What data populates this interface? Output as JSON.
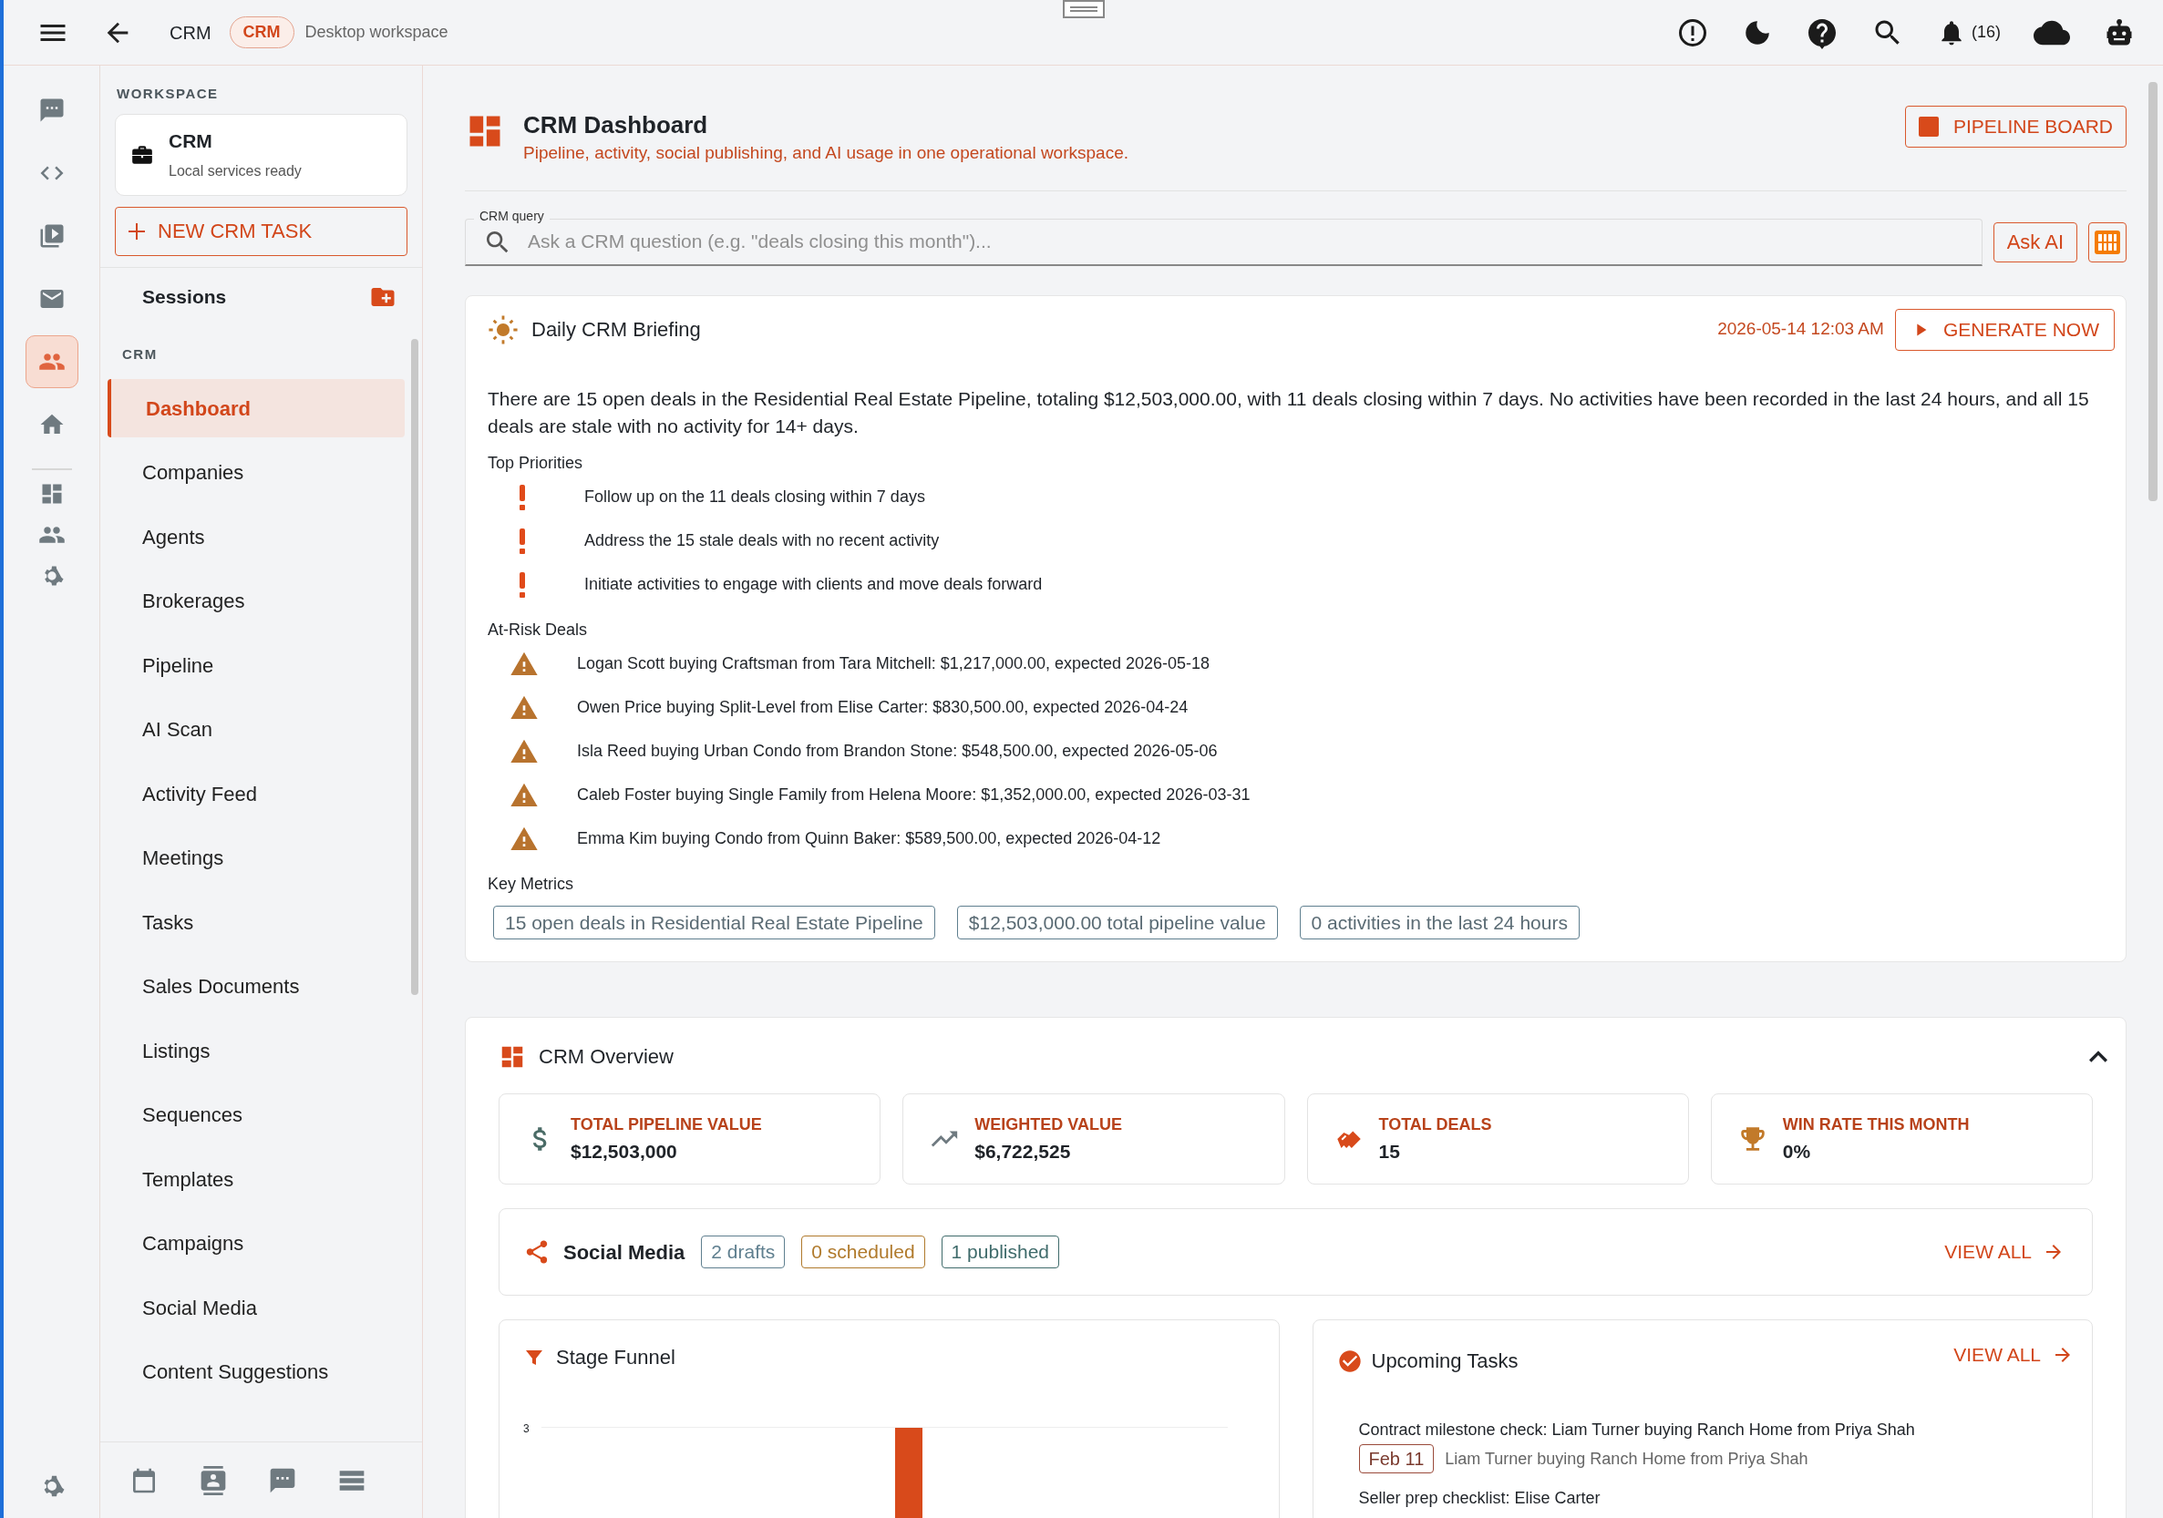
{
  "topbar": {
    "breadcrumb": "CRM",
    "badge": "CRM",
    "subtitle": "Desktop workspace",
    "notification_count": "(16)"
  },
  "rail": [
    {
      "selected": false
    },
    {
      "selected": false
    },
    {
      "selected": false
    },
    {
      "selected": false
    },
    {
      "selected": true
    },
    {
      "selected": false
    }
  ],
  "sidebar": {
    "workspace_label": "WORKSPACE",
    "workspace_card": {
      "title": "CRM",
      "status": "Local services ready"
    },
    "new_task_button": "NEW CRM TASK",
    "sessions_label": "Sessions",
    "section_label": "CRM",
    "items": [
      {
        "label": "Dashboard",
        "selected": true
      },
      {
        "label": "Companies",
        "selected": false
      },
      {
        "label": "Agents",
        "selected": false
      },
      {
        "label": "Brokerages",
        "selected": false
      },
      {
        "label": "Pipeline",
        "selected": false
      },
      {
        "label": "AI Scan",
        "selected": false
      },
      {
        "label": "Activity Feed",
        "selected": false
      },
      {
        "label": "Meetings",
        "selected": false
      },
      {
        "label": "Tasks",
        "selected": false
      },
      {
        "label": "Sales Documents",
        "selected": false
      },
      {
        "label": "Listings",
        "selected": false
      },
      {
        "label": "Sequences",
        "selected": false
      },
      {
        "label": "Templates",
        "selected": false
      },
      {
        "label": "Campaigns",
        "selected": false
      },
      {
        "label": "Social Media",
        "selected": false
      },
      {
        "label": "Content Suggestions",
        "selected": false
      }
    ]
  },
  "header": {
    "title": "CRM Dashboard",
    "subtitle": "Pipeline, activity, social publishing, and AI usage in one operational workspace.",
    "pipeline_button": "PIPELINE BOARD"
  },
  "query": {
    "label": "CRM query",
    "placeholder": "Ask a CRM question (e.g. \"deals closing this month\")...",
    "ask_button": "Ask AI"
  },
  "briefing": {
    "title": "Daily CRM Briefing",
    "timestamp": "2026-05-14 12:03 AM",
    "generate_button": "GENERATE NOW",
    "summary": "There are 15 open deals in the Residential Real Estate Pipeline, totaling $12,503,000.00, with 11 deals closing within 7 days. No activities have been recorded in the last 24 hours, and all 15 deals are stale with no activity for 14+ days.",
    "priorities_title": "Top Priorities",
    "priorities": [
      "Follow up on the 11 deals closing within 7 days",
      "Address the 15 stale deals with no recent activity",
      "Initiate activities to engage with clients and move deals forward"
    ],
    "at_risk_title": "At-Risk Deals",
    "at_risk": [
      "Logan Scott buying Craftsman from Tara Mitchell: $1,217,000.00, expected 2026-05-18",
      "Owen Price buying Split-Level from Elise Carter: $830,500.00, expected 2026-04-24",
      "Isla Reed buying Urban Condo from Brandon Stone: $548,500.00, expected 2026-05-06",
      "Caleb Foster buying Single Family from Helena Moore: $1,352,000.00, expected 2026-03-31",
      "Emma Kim buying Condo from Quinn Baker: $589,500.00, expected 2026-04-12"
    ],
    "metrics_title": "Key Metrics",
    "metrics": [
      "15 open deals in Residential Real Estate Pipeline",
      "$12,503,000.00 total pipeline value",
      "0 activities in the last 24 hours"
    ]
  },
  "overview": {
    "title": "CRM Overview",
    "expanded": true,
    "stats": [
      {
        "label": "TOTAL PIPELINE VALUE",
        "value": "$12,503,000"
      },
      {
        "label": "WEIGHTED VALUE",
        "value": "$6,722,525"
      },
      {
        "label": "TOTAL DEALS",
        "value": "15"
      },
      {
        "label": "WIN RATE THIS MONTH",
        "value": "0%"
      }
    ],
    "social": {
      "title": "Social Media",
      "tags": [
        {
          "label": "2 drafts",
          "color": "#5f7f8f"
        },
        {
          "label": "0 scheduled",
          "color": "#b07a2c"
        },
        {
          "label": "1 published",
          "color": "#3f6b6b"
        }
      ],
      "view_all": "VIEW ALL"
    },
    "funnel": {
      "title": "Stage Funnel",
      "y_tick": "3"
    },
    "tasks": {
      "title": "Upcoming Tasks",
      "view_all": "VIEW ALL",
      "items": [
        {
          "title": "Contract milestone check: Liam Turner buying Ranch Home from Priya Shah",
          "date": "Feb 11",
          "detail": "Liam Turner buying Ranch Home from Priya Shah"
        },
        {
          "title": "Seller prep checklist: Elise Carter"
        }
      ]
    }
  }
}
